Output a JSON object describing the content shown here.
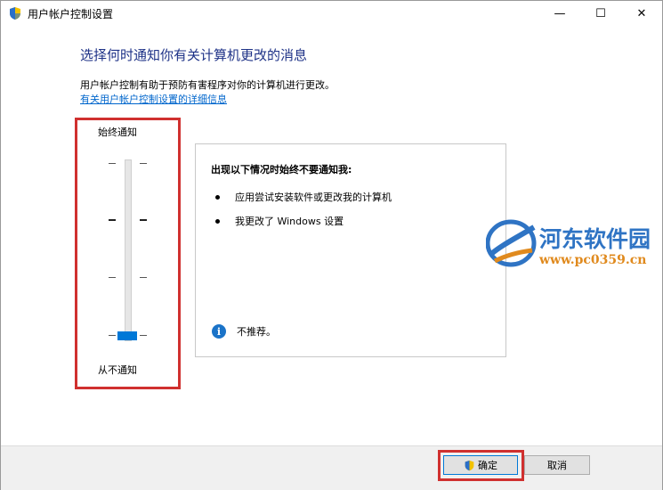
{
  "window": {
    "title": "用户帐户控制设置",
    "minimize_glyph": "—",
    "maximize_glyph": "☐",
    "close_glyph": "✕"
  },
  "header": {
    "heading": "选择何时通知你有关计算机更改的消息",
    "description": "用户帐户控制有助于预防有害程序对你的计算机进行更改。",
    "details_link": "有关用户帐户控制设置的详细信息"
  },
  "slider": {
    "top_label": "始终通知",
    "bottom_label": "从不通知",
    "levels": 4,
    "selected_level": 0
  },
  "panel": {
    "heading": "出现以下情况时始终不要通知我:",
    "bullets": [
      "应用尝试安装软件或更改我的计算机",
      "我更改了 Windows 设置"
    ],
    "recommendation": "不推荐。",
    "info_icon_glyph": "i"
  },
  "watermark": {
    "brand": "河东软件园",
    "url": "www.pc0359.cn"
  },
  "buttons": {
    "ok": "确定",
    "cancel": "取消"
  },
  "colors": {
    "accent": "#0078d7",
    "heading": "#1e3287",
    "link": "#0066cc",
    "highlight": "#d0302f"
  },
  "icons": {
    "title": "uac-shield-icon",
    "ok_button": "uac-shield-icon",
    "info": "info-icon"
  }
}
